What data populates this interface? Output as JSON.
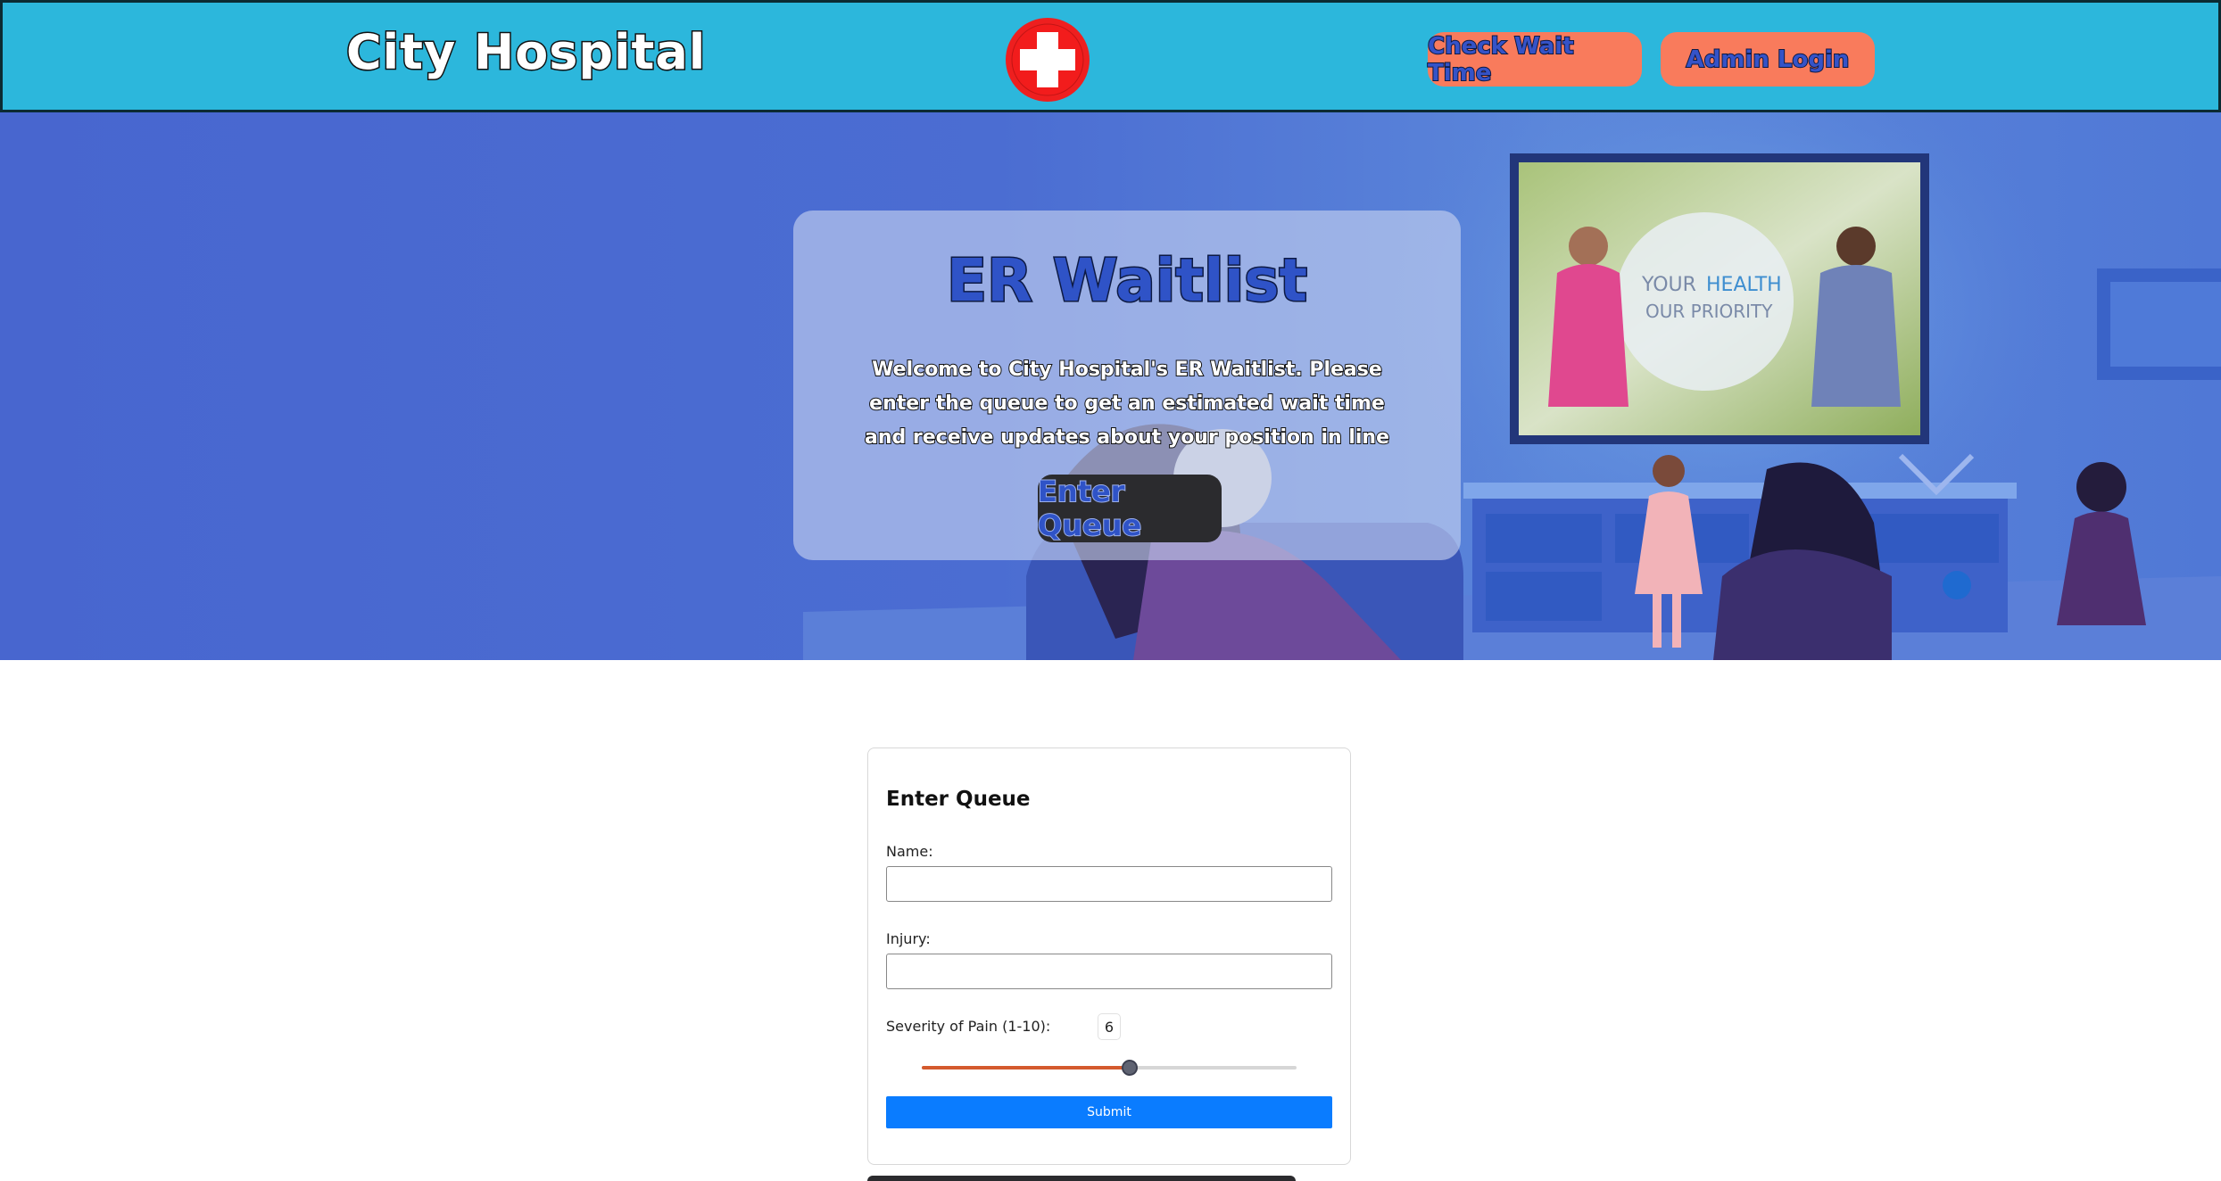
{
  "header": {
    "brand": "City Hospital",
    "nav": {
      "check_wait": "Check Wait Time",
      "admin_login": "Admin Login"
    },
    "logo_icon": "red-cross-icon"
  },
  "hero": {
    "title": "ER Waitlist",
    "text": "Welcome to City Hospital's ER Waitlist. Please enter the queue to get an estimated wait time and receive updates about your position in line",
    "button": "Enter Queue",
    "tv_text": {
      "line1a": "YOUR",
      "line1b": "HEALTH",
      "line2": "OUR PRIORITY"
    }
  },
  "form": {
    "title": "Enter Queue",
    "name_label": "Name:",
    "name_value": "",
    "injury_label": "Injury:",
    "injury_value": "",
    "severity_label": "Severity of Pain (1-10):",
    "severity_value": "6",
    "severity_min": 1,
    "severity_max": 10,
    "submit": "Submit"
  },
  "colors": {
    "header_bg": "#2cb7dc",
    "nav_button": "#f97b5c",
    "hero_bg": "#4a6fd1",
    "submit": "#0a7cff",
    "slider_fill": "#d45a2e"
  }
}
